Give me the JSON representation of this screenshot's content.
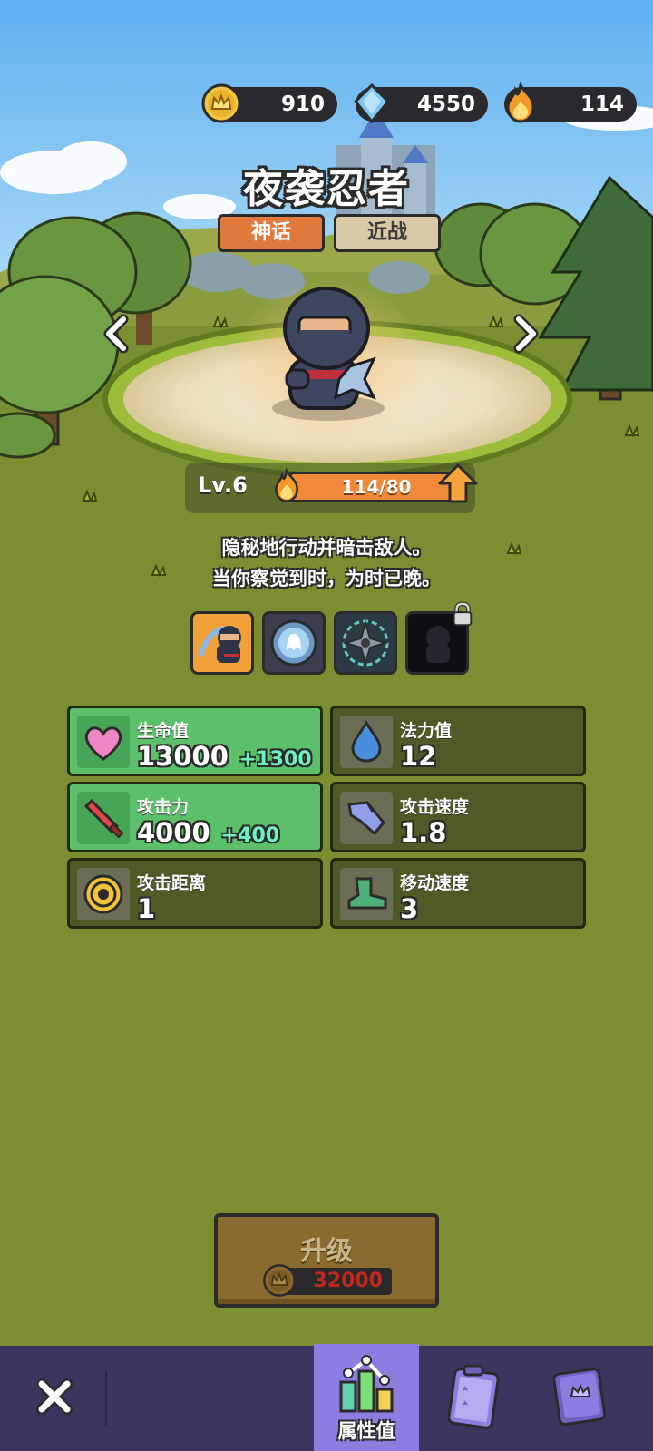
{
  "currency": {
    "crowns": {
      "icon": "crown-coin-icon",
      "value": "910"
    },
    "gems": {
      "icon": "diamond-gem-icon",
      "value": "4550"
    },
    "fire": {
      "icon": "fire-icon",
      "value": "114"
    }
  },
  "hero": {
    "name": "夜袭忍者",
    "rarity": "神话",
    "type": "近战",
    "level": "Lv.6",
    "xp_text": "114/80",
    "xp_fraction": 1.0,
    "description_line1": "隐秘地行动并暗击敌人。",
    "description_line2": "当你察觉到时，为时已晚。"
  },
  "skins": [
    {
      "name": "ninja-skin-selected",
      "locked": false,
      "selected": true
    },
    {
      "name": "ghost-orb-skill",
      "locked": false,
      "selected": false
    },
    {
      "name": "shuriken-skill",
      "locked": false,
      "selected": false
    },
    {
      "name": "shadow-ninja-skin",
      "locked": true,
      "selected": false
    }
  ],
  "stats": {
    "hp": {
      "label": "生命值",
      "value": "13000",
      "bonus": "+1300",
      "icon": "heart-icon"
    },
    "mana": {
      "label": "法力值",
      "value": "12",
      "icon": "water-drop-icon"
    },
    "attack": {
      "label": "攻击力",
      "value": "4000",
      "bonus": "+400",
      "icon": "sword-icon"
    },
    "attack_speed": {
      "label": "攻击速度",
      "value": "1.8",
      "icon": "gauntlet-icon"
    },
    "attack_range": {
      "label": "攻击距离",
      "value": "1",
      "icon": "target-icon"
    },
    "move_speed": {
      "label": "移动速度",
      "value": "3",
      "icon": "boot-icon"
    }
  },
  "upgrade": {
    "label": "升级",
    "cost": "32000",
    "cost_icon": "crown-coin-icon"
  },
  "nav": {
    "close_icon": "close-icon",
    "stats_label": "属性值",
    "stats_icon": "bar-chart-icon",
    "quests_icon": "clipboard-icon",
    "book_icon": "book-icon"
  },
  "colors": {
    "sky": "#6fb9ee",
    "grass": "#7a8f32",
    "rarity_tag": "#e07a3c",
    "type_tag": "#d9c9a6",
    "xp_fill": "#f08a3a",
    "stat_boost": "#5cc06a",
    "stat_plain": "#4f5a26",
    "upgrade_button": "#8a6a2e",
    "nav_bar": "#3c3560",
    "nav_active": "#8c7ee0"
  }
}
